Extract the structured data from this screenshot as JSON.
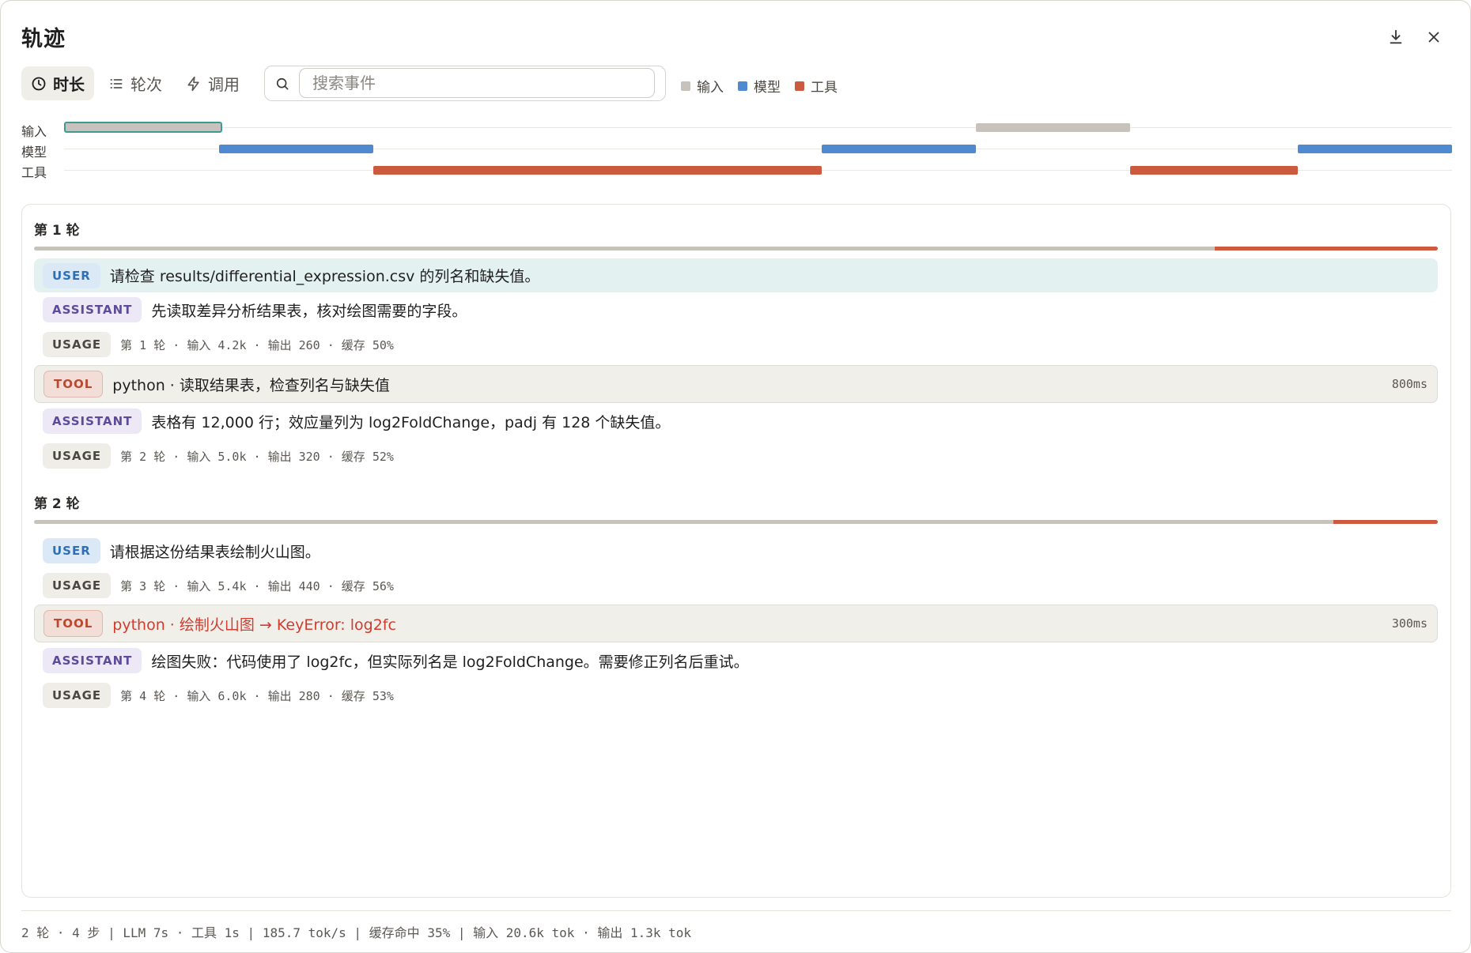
{
  "header": {
    "title": "轨迹",
    "download_icon": "download-icon",
    "close_icon": "close-icon"
  },
  "toolbar": {
    "tabs": [
      {
        "label": "时长",
        "icon": "clock-icon",
        "active": true
      },
      {
        "label": "轮次",
        "icon": "list-icon",
        "active": false
      },
      {
        "label": "调用",
        "icon": "lightning-icon",
        "active": false
      }
    ],
    "search": {
      "placeholder": "搜索事件",
      "value": ""
    },
    "legend": [
      {
        "label": "输入",
        "color": "#c7c2bb"
      },
      {
        "label": "模型",
        "color": "#4f89cf"
      },
      {
        "label": "工具",
        "color": "#cc5a3f"
      }
    ]
  },
  "timeline": {
    "lanes": [
      "输入",
      "模型",
      "工具"
    ]
  },
  "rounds": [
    {
      "title": "第 1 轮",
      "events": [
        {
          "type": "USER",
          "text": "请检查 results/differential_expression.csv 的列名和缺失值。"
        },
        {
          "type": "ASSISTANT",
          "text": "先读取差异分析结果表，核对绘图需要的字段。"
        },
        {
          "type": "USAGE",
          "text": "第 1 轮 · 输入 4.2k · 输出 260 · 缓存 50%"
        },
        {
          "type": "TOOL",
          "text": "python · 读取结果表，检查列名与缺失值",
          "duration": "800ms"
        },
        {
          "type": "ASSISTANT",
          "text": "表格有 12,000 行；效应量列为 log2FoldChange，padj 有 128 个缺失值。"
        },
        {
          "type": "USAGE",
          "text": "第 2 轮 · 输入 5.0k · 输出 320 · 缓存 52%"
        }
      ]
    },
    {
      "title": "第 2 轮",
      "events": [
        {
          "type": "USER",
          "text": "请根据这份结果表绘制火山图。"
        },
        {
          "type": "USAGE",
          "text": "第 3 轮 · 输入 5.4k · 输出 440 · 缓存 56%"
        },
        {
          "type": "TOOL",
          "text": "python · 绘制火山图 → KeyError: log2fc",
          "duration": "300ms"
        },
        {
          "type": "ASSISTANT",
          "text": "绘图失败：代码使用了 log2fc，但实际列名是 log2FoldChange。需要修正列名后重试。"
        },
        {
          "type": "USAGE",
          "text": "第 4 轮 · 输入 6.0k · 输出 280 · 缓存 53%"
        }
      ]
    }
  ],
  "footer": {
    "summary": "2 轮 · 4 步 | LLM 7s · 工具 1s | 185.7 tok/s | 缓存命中 35% | 输入 20.6k tok · 输出 1.3k tok"
  }
}
